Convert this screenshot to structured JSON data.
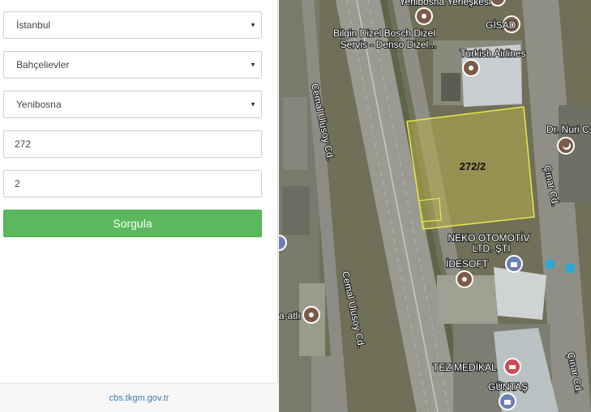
{
  "form": {
    "province": "İstanbul",
    "district": "Bahçelievler",
    "neighborhood": "Yenibosna",
    "block": "272",
    "parcel": "2",
    "query_label": "Sorgula"
  },
  "footer": {
    "site": "cbs.tkgm.gov.tr"
  },
  "map": {
    "parcel_label": "272/2",
    "parcel_color": "#e8e84a",
    "poi": {
      "yenibosna": "Yenibosna Yerleşkesi",
      "gisad": "GİSAD",
      "bilgin_1": "Bilgin Dizel Bosch Dizel",
      "bilgin_2": "Servis - Denso Dizel...",
      "turkish": "Turkish Airlines",
      "nuri": "Dr. Nuri C",
      "neko_1": "NEKO OTOMOTİV",
      "neko_2": "LTD. ŞTİ",
      "idesoft": "İDESOFT",
      "atli": "a-atlı",
      "tez": "TEZ MEDİKAL",
      "guntas": "GÜNTAŞ",
      "road_cemal_1": "Cemal Ulusoy Cd.",
      "road_cemal_2": "Cemal Ulusoy Cd.",
      "road_cinar_1": "Çınar Cd.",
      "road_cinar_2": "Çınar Cd."
    }
  }
}
